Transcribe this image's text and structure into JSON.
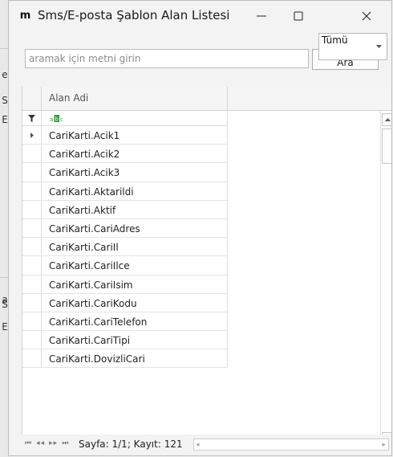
{
  "window": {
    "title": "Sms/E-posta Şablon Alan Listesi",
    "logo": "m"
  },
  "background": {
    "letters": [
      "e",
      "S",
      "E",
      "a",
      "S",
      "E"
    ]
  },
  "search": {
    "placeholder": "aramak için metni girin",
    "value": "",
    "button_label": "Ara"
  },
  "filter": {
    "selected": "Tümü"
  },
  "grid": {
    "column_header": "Alan Adi",
    "rows": [
      "CariKarti.Acik1",
      "CariKarti.Acik2",
      "CariKarti.Acik3",
      "CariKarti.Aktarildi",
      "CariKarti.Aktif",
      "CariKarti.CariAdres",
      "CariKarti.CariIl",
      "CariKarti.CariIlce",
      "CariKarti.CariIsim",
      "CariKarti.CariKodu",
      "CariKarti.CariTelefon",
      "CariKarti.CariTipi",
      "CariKarti.DovizliCari"
    ]
  },
  "footer": {
    "page_info": "Sayfa: 1/1; Kayıt: 121"
  },
  "colors": {
    "abc_green": "#2e9e3a"
  }
}
